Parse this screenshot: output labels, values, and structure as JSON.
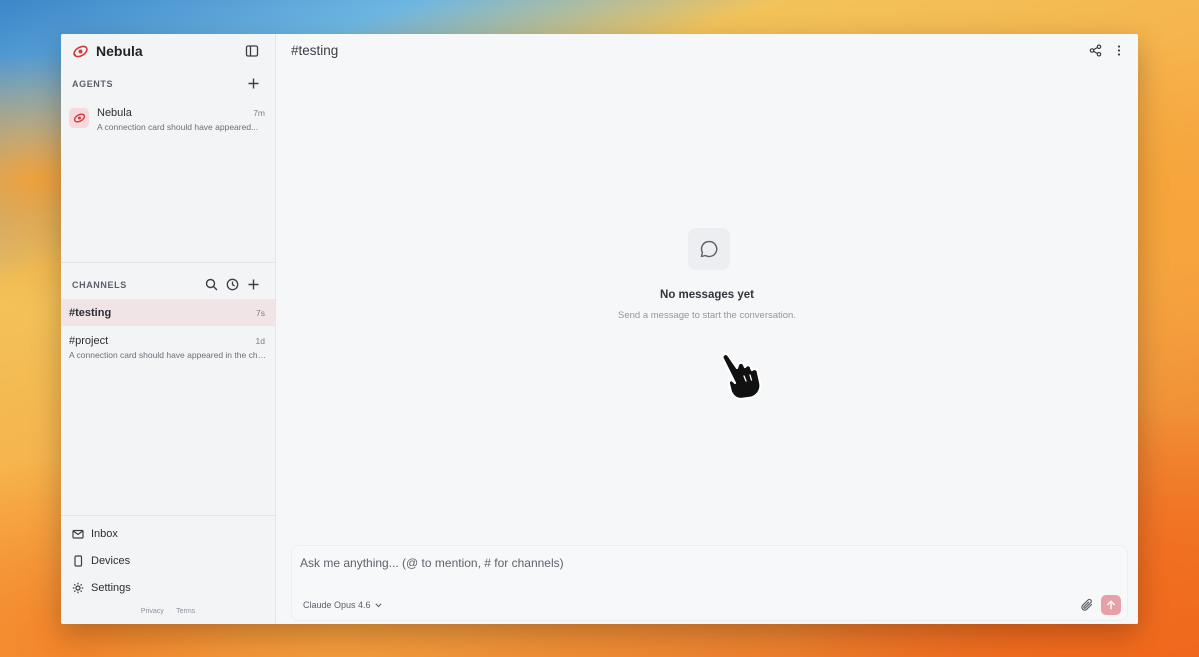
{
  "app": {
    "name": "Nebula",
    "logo_icon": "nebula-logo-icon"
  },
  "sidebar": {
    "agents_header": "AGENTS",
    "agents": [
      {
        "name": "Nebula",
        "time": "7m",
        "preview": "A connection card should have appeared..."
      }
    ],
    "channels_header": "CHANNELS",
    "channels": [
      {
        "name": "#testing",
        "time": "7s",
        "preview": "",
        "active": true
      },
      {
        "name": "#project",
        "time": "1d",
        "preview": "A connection card should have appeared in the channel",
        "active": false
      }
    ],
    "nav": [
      {
        "label": "Inbox",
        "icon": "mail-icon"
      },
      {
        "label": "Devices",
        "icon": "phone-icon"
      },
      {
        "label": "Settings",
        "icon": "gear-icon"
      }
    ],
    "footer": {
      "privacy": "Privacy",
      "terms": "Terms"
    }
  },
  "main": {
    "channel_title": "#testing",
    "empty_state": {
      "title": "No messages yet",
      "subtitle": "Send a message to start the conversation.",
      "icon": "chat-bubble-icon"
    },
    "composer": {
      "placeholder": "Ask me anything... (@ to mention, # for channels)",
      "value": "",
      "model": "Claude Opus 4.6"
    }
  },
  "colors": {
    "accent": "#e8a0a8",
    "active_channel": "#f0e4e6",
    "brand_red": "#d23a3a"
  }
}
